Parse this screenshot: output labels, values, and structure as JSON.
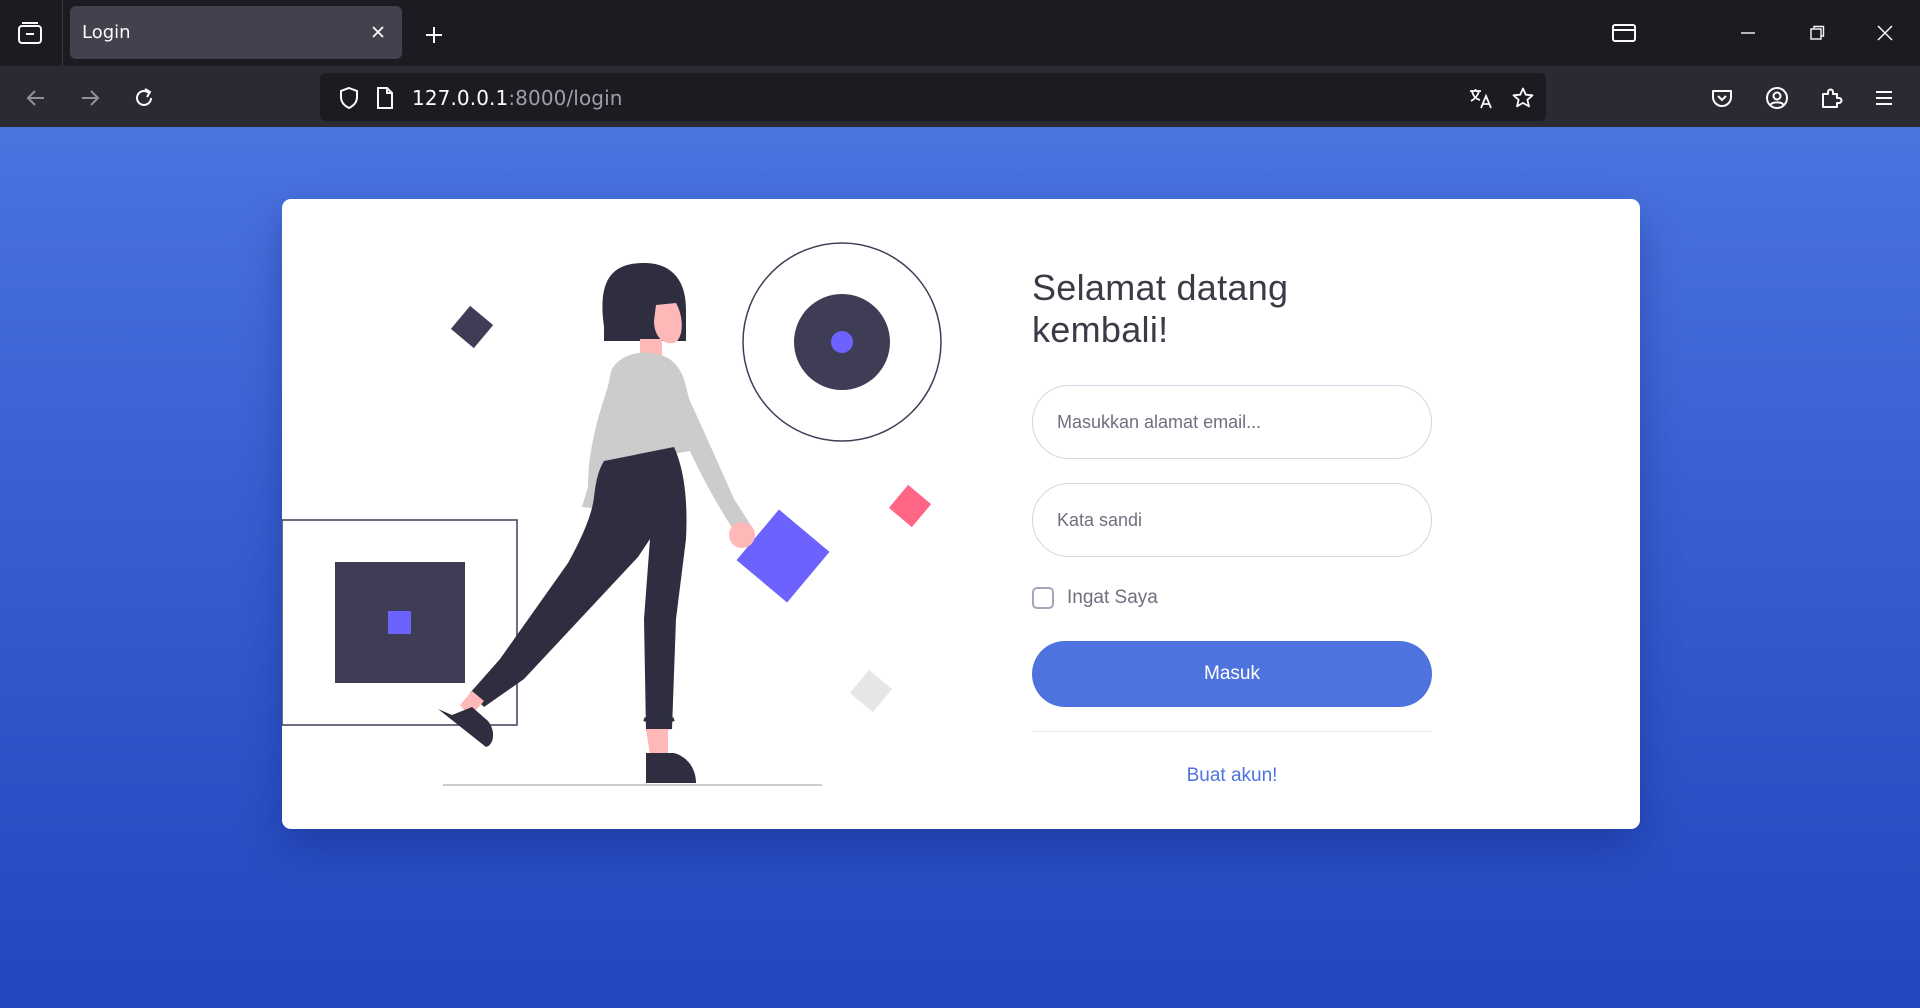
{
  "browser": {
    "tab_title": "Login",
    "url_host": "127.0.0.1",
    "url_rest": ":8000/login"
  },
  "icons": {
    "tab_manager": "tab-manager-icon",
    "close_tab": "close-icon",
    "new_tab": "plus-icon",
    "back": "arrow-left-icon",
    "forward": "arrow-right-icon",
    "reload": "reload-icon",
    "shield": "shield-icon",
    "page": "page-icon",
    "translate": "translate-icon",
    "bookmark": "star-icon",
    "pocket": "pocket-icon",
    "account": "account-icon",
    "extensions": "puzzle-icon",
    "menu": "hamburger-icon"
  },
  "login": {
    "heading": "Selamat datang kembali!",
    "email_placeholder": "Masukkan alamat email...",
    "password_placeholder": "Kata sandi",
    "remember_label": "Ingat Saya",
    "remember_checked": false,
    "submit_label": "Masuk",
    "register_link": "Buat akun!"
  },
  "colors": {
    "primary": "#4e73df",
    "background_top": "#4b74df",
    "background_bottom": "#2247bd",
    "illustration_dark": "#3f3d56",
    "illustration_accent": "#6c63ff",
    "illustration_pink": "#ff6584"
  }
}
